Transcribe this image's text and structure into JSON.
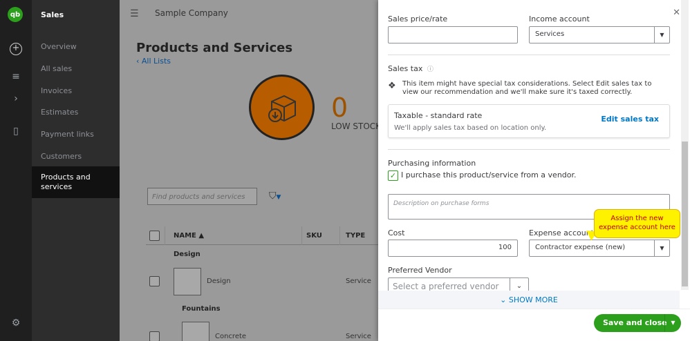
{
  "rail": {
    "logo": "qb"
  },
  "nav": {
    "title": "Sales",
    "items": [
      "Overview",
      "All sales",
      "Invoices",
      "Estimates",
      "Payment links",
      "Customers"
    ],
    "active": "Products and services"
  },
  "main": {
    "company": "Sample Company",
    "title": "Products and Services",
    "all_lists": "All Lists",
    "stock_count": "0",
    "stock_label": "LOW STOCK",
    "find_placeholder": "Find products and services",
    "columns": [
      "NAME ▲",
      "SKU",
      "TYPE"
    ],
    "groups": [
      "Design",
      "Fountains"
    ],
    "rows": [
      {
        "name": "Design",
        "type": "Service"
      },
      {
        "name": "Concrete",
        "type": "Service"
      }
    ]
  },
  "panel": {
    "sales_price_label": "Sales price/rate",
    "sales_price_value": "",
    "income_account_label": "Income account",
    "income_account_value": "Services",
    "sales_tax_label": "Sales tax",
    "sales_tax_note": "This item might have special tax considerations. Select Edit sales tax to view our recommendation and we'll make sure it's taxed correctly.",
    "tax_title": "Taxable - standard rate",
    "tax_subtitle": "We'll apply sales tax based on location only.",
    "edit_tax": "Edit sales tax",
    "purchasing_label": "Purchasing information",
    "purchase_checkbox_label": "I purchase this product/service from a vendor.",
    "description_placeholder": "Description on purchase forms",
    "cost_label": "Cost",
    "cost_value": "100",
    "expense_account_label": "Expense account",
    "expense_account_value": "Contractor expense (new)",
    "callout": "Assign the new expense account here",
    "preferred_vendor_label": "Preferred Vendor",
    "preferred_vendor_placeholder": "Select a preferred vendor",
    "show_more": "SHOW MORE",
    "save_button": "Save and close"
  },
  "colors": {
    "brand_green": "#2ca01c",
    "link_blue": "#0077c5",
    "callout_yellow": "#fff200",
    "callout_text": "#c00000"
  }
}
